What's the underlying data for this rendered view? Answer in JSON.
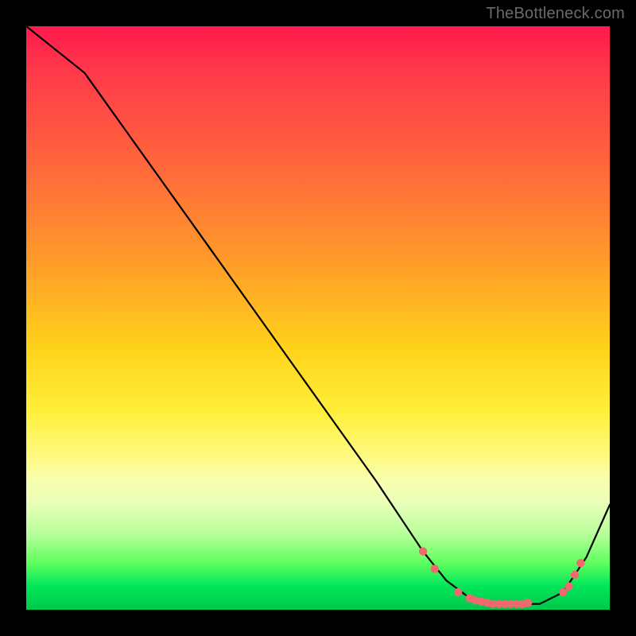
{
  "watermark": "TheBottleneck.com",
  "colors": {
    "frame_bg": "#000000",
    "curve": "#000000",
    "dot": "#ef6a6e"
  },
  "chart_data": {
    "type": "line",
    "title": "",
    "xlabel": "",
    "ylabel": "",
    "xlim": [
      0,
      100
    ],
    "ylim": [
      0,
      100
    ],
    "series": [
      {
        "name": "bottleneck-curve",
        "x": [
          0,
          10,
          20,
          30,
          40,
          50,
          60,
          68,
          72,
          76,
          80,
          84,
          88,
          92,
          96,
          100
        ],
        "y": [
          100,
          92,
          78,
          64,
          50,
          36,
          22,
          10,
          5,
          2,
          1,
          1,
          1,
          3,
          9,
          18
        ]
      }
    ],
    "markers": {
      "name": "highlight-dots",
      "x": [
        68,
        70,
        74,
        76,
        77,
        78,
        79,
        80,
        81,
        82,
        83,
        84,
        85,
        86,
        92,
        93,
        94,
        95
      ],
      "y": [
        10,
        7,
        3,
        2,
        1.6,
        1.4,
        1.2,
        1,
        1,
        1,
        1,
        1,
        1,
        1.2,
        3,
        4,
        6,
        8
      ]
    }
  }
}
